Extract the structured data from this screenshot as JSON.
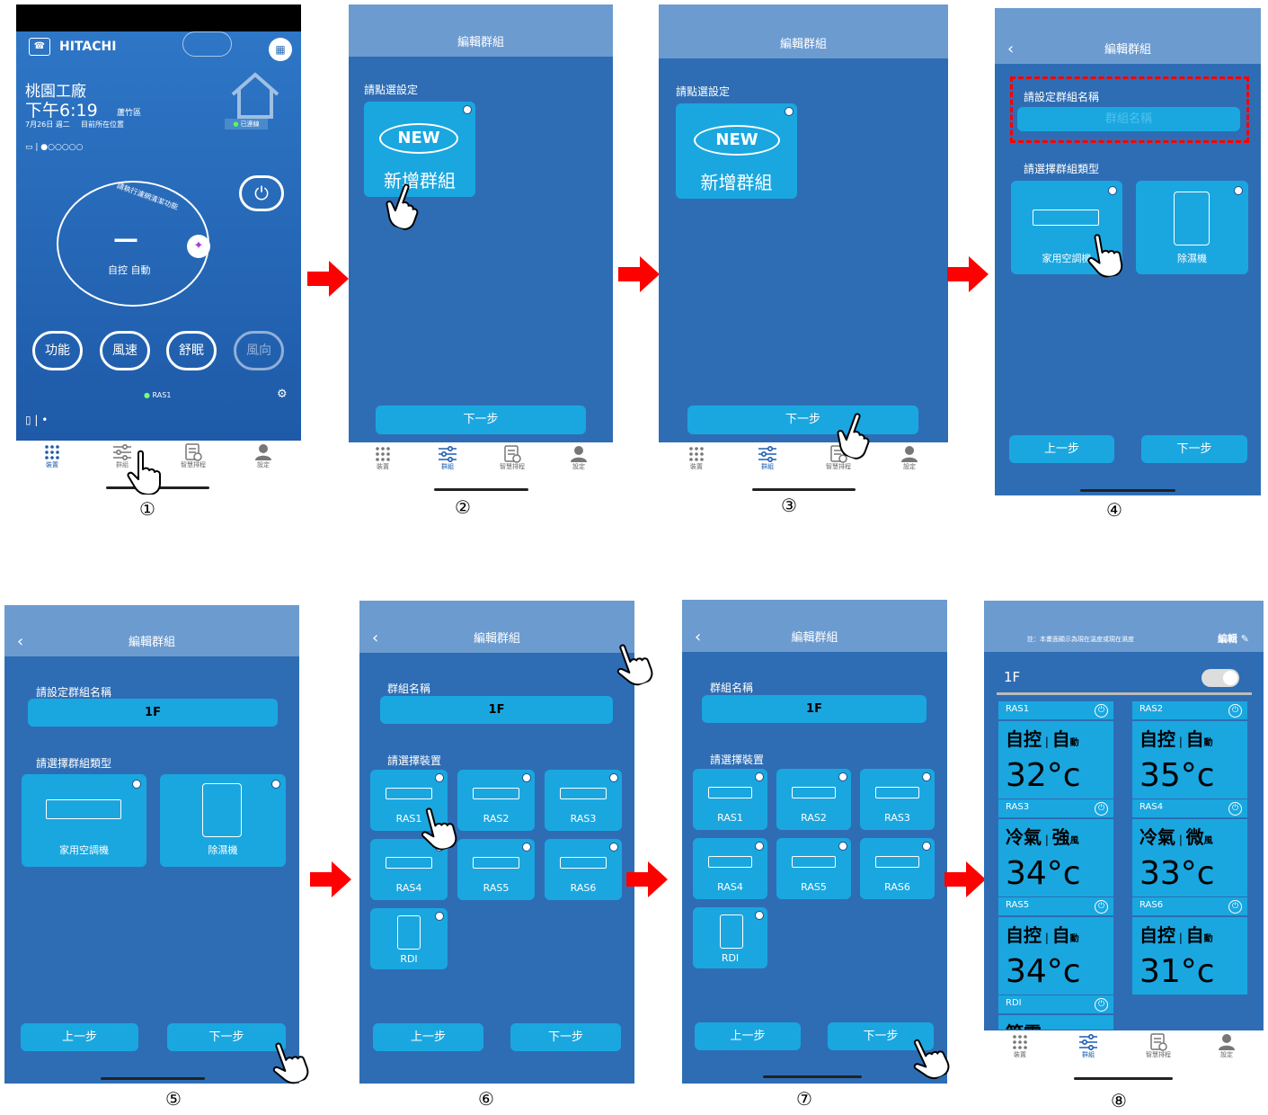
{
  "colors": {
    "primary": "#2e6db4",
    "header": "#6c9bd0",
    "button": "#1aa7e0",
    "arrow": "#ff0000",
    "dashed": "#ff0000",
    "nav_active": "#1b5bb0"
  },
  "step_numbers": [
    "①",
    "②",
    "③",
    "④",
    "⑤",
    "⑥",
    "⑦",
    "⑧"
  ],
  "nav": {
    "devices": "裝置",
    "groups": "群組",
    "schedule": "智慧排程",
    "settings": "設定",
    "icons": [
      "grid-icon",
      "sliders-icon",
      "schedule-icon",
      "user-icon"
    ]
  },
  "home": {
    "brand": "HITACHI",
    "location": "桃園工廠",
    "time": "下午6:19",
    "district": "蘆竹區",
    "date": "7月26日 週二",
    "position_note": "目前所在位置",
    "connected": "已連線",
    "dial_arc": "請執行濾網清潔功能",
    "dial_value": "—",
    "dial_mode": "自控",
    "dial_fan": "自動",
    "buttons": [
      "功能",
      "風速",
      "舒眠",
      "風向"
    ],
    "device": "RAS1"
  },
  "common": {
    "title": "編輯群組",
    "next": "下一步",
    "prev": "上一步"
  },
  "step2": {
    "prompt": "請點選設定",
    "badge": "NEW",
    "new_group": "新增群組"
  },
  "step4": {
    "name_label": "請設定群組名稱",
    "name_placeholder": "群組名稱",
    "type_label": "請選擇群組類型",
    "type_ac": "家用空調機",
    "type_dehum": "除濕機"
  },
  "step5": {
    "name_value": "1F"
  },
  "step6": {
    "name_label": "群組名稱",
    "name_value": "1F",
    "select_label": "請選擇裝置",
    "devices": [
      "RAS1",
      "RAS2",
      "RAS3",
      "RAS4",
      "RAS5",
      "RAS6",
      "RDI"
    ]
  },
  "step8": {
    "note": "註：本畫面顯示為現在溫度或現在濕度",
    "edit": "編輯",
    "group": "1F",
    "cards": [
      {
        "name": "RAS1",
        "mode": "自控",
        "fan": "自",
        "fan_sub": "動",
        "temp": "32°c"
      },
      {
        "name": "RAS2",
        "mode": "自控",
        "fan": "自",
        "fan_sub": "動",
        "temp": "35°c"
      },
      {
        "name": "RAS3",
        "mode": "冷氣",
        "fan": "強",
        "fan_sub": "風",
        "temp": "34°c"
      },
      {
        "name": "RAS4",
        "mode": "冷氣",
        "fan": "微",
        "fan_sub": "風",
        "temp": "33°c"
      },
      {
        "name": "RAS5",
        "mode": "自控",
        "fan": "自",
        "fan_sub": "動",
        "temp": "34°c"
      },
      {
        "name": "RAS6",
        "mode": "自控",
        "fan": "自",
        "fan_sub": "動",
        "temp": "31°c"
      },
      {
        "name": "RDI",
        "mode": "節電",
        "fan": "",
        "fan_sub": "",
        "temp": ""
      }
    ]
  }
}
